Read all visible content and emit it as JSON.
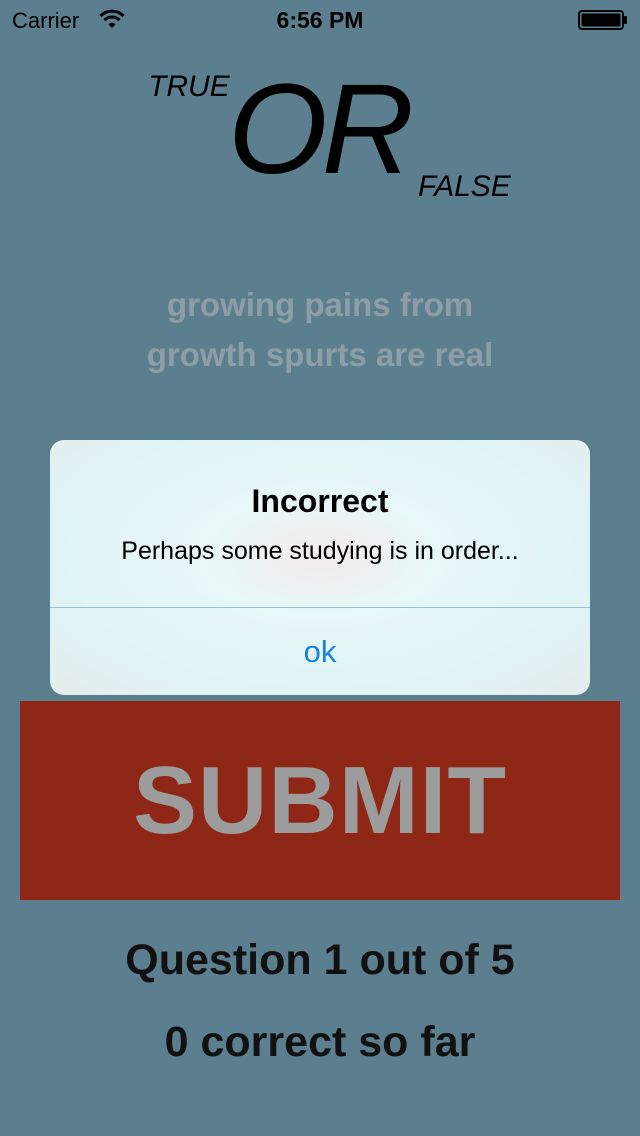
{
  "status_bar": {
    "carrier": "Carrier",
    "time": "6:56 PM",
    "icons": [
      "wifi-icon",
      "battery-icon"
    ]
  },
  "logo": {
    "true_text": "TRUE",
    "or_text": "OR",
    "false_text": "FALSE"
  },
  "statement": {
    "line1": "growing pains from",
    "line2": "growth spurts are real"
  },
  "submit": {
    "label": "SUBMIT"
  },
  "progress": {
    "question_text": "Question 1 out of 5",
    "score_text": "0 correct so far"
  },
  "alert": {
    "title": "Incorrect",
    "message": "Perhaps some studying is in order...",
    "ok_label": "ok"
  },
  "colors": {
    "background": "#5c7f90",
    "submit_background": "#8e2716",
    "submit_text": "#9c9c9c",
    "statement_text": "#8e9ea6",
    "alert_button": "#1a82e0"
  }
}
